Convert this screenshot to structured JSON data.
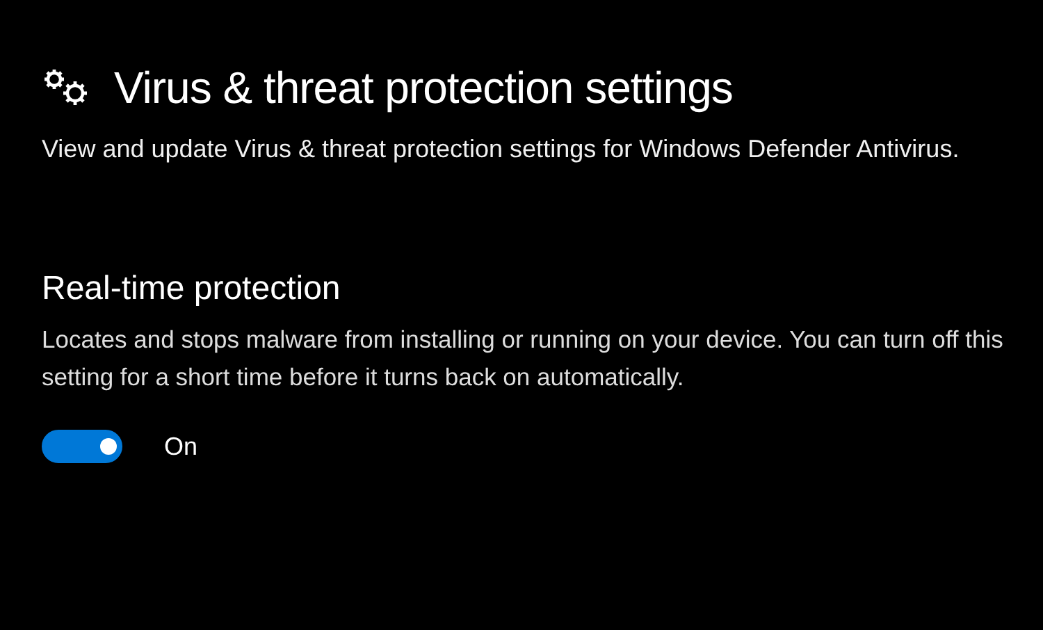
{
  "header": {
    "title": "Virus & threat protection settings",
    "description": "View and update Virus & threat protection settings for Windows Defender Antivirus."
  },
  "section": {
    "title": "Real-time protection",
    "description": "Locates and stops malware from installing or running on your device. You can turn off this setting for a short time before it turns back on automatically.",
    "toggle": {
      "on": true,
      "label": "On"
    }
  }
}
